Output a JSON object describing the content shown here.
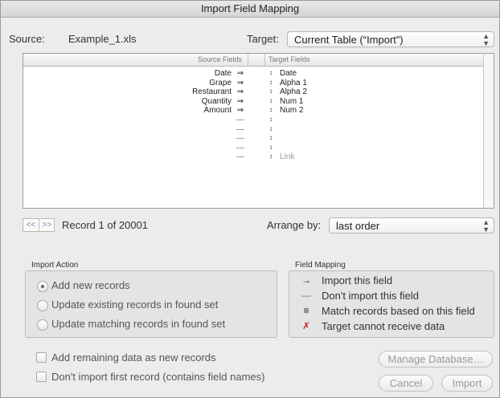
{
  "window": {
    "title": "Import Field Mapping"
  },
  "source": {
    "label": "Source:",
    "file": "Example_1.xls"
  },
  "target": {
    "label": "Target:",
    "value": "Current Table (“Import”)"
  },
  "list": {
    "source_header": "Source Fields",
    "target_header": "Target Fields",
    "rows": [
      {
        "source": "Date",
        "arrow": "⇒",
        "target": "Date"
      },
      {
        "source": "Grape",
        "arrow": "⇒",
        "target": "Alpha 1"
      },
      {
        "source": "Restaurant",
        "arrow": "⇒",
        "target": "Alpha 2"
      },
      {
        "source": "Quantity",
        "arrow": "⇒",
        "target": "Num 1"
      },
      {
        "source": "Amount",
        "arrow": "⇒",
        "target": "Num 2"
      },
      {
        "source": "",
        "arrow": "—",
        "target": ""
      },
      {
        "source": "",
        "arrow": "—",
        "target": ""
      },
      {
        "source": "",
        "arrow": "—",
        "target": ""
      },
      {
        "source": "",
        "arrow": "—",
        "target": ""
      },
      {
        "source": "",
        "arrow": "—",
        "target": "Link"
      }
    ]
  },
  "nav": {
    "prev": "<<",
    "next": ">>",
    "record_text": "Record 1 of 20001"
  },
  "arrange": {
    "label": "Arrange by:",
    "value": "last order"
  },
  "import_action": {
    "title": "Import Action",
    "options": [
      "Add new records",
      "Update existing records in found set",
      "Update matching records in found set"
    ],
    "selected": "Add new records"
  },
  "field_mapping": {
    "title": "Field Mapping",
    "items": [
      {
        "icon": "→",
        "text": "Import this field"
      },
      {
        "icon": "—",
        "text": "Don't import this field"
      },
      {
        "icon": "≡",
        "text": "Match records based on this field"
      },
      {
        "icon": "✗",
        "text": "Target cannot receive data"
      }
    ]
  },
  "checkboxes": {
    "add_remaining": "Add remaining data as new records",
    "dont_import_first": "Don't import first record (contains field names)"
  },
  "buttons": {
    "manage": "Manage Database…",
    "cancel": "Cancel",
    "import": "Import"
  },
  "colors": {
    "accent_red": "#cc2222",
    "link_blue": "#6a8fb8"
  }
}
